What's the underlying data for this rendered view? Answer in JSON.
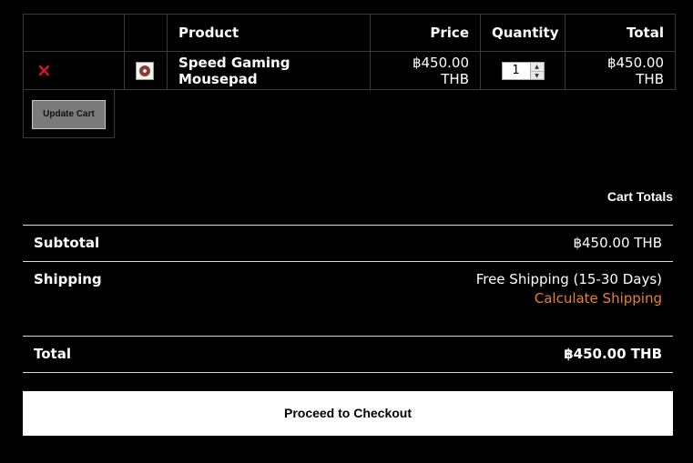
{
  "cart": {
    "columns": {
      "remove": "",
      "thumbnail": "",
      "product": "Product",
      "price": "Price",
      "quantity": "Quantity",
      "total": "Total"
    },
    "items": [
      {
        "remove_icon": "×",
        "thumbnail_icon": "mousepad-thumbnail",
        "product": "Speed Gaming Mousepad",
        "price": "฿450.00 THB",
        "quantity": "1",
        "total": "฿450.00 THB"
      }
    ],
    "update_button": "Update Cart"
  },
  "totals": {
    "heading": "Cart Totals",
    "subtotal_label": "Subtotal",
    "subtotal_value": "฿450.00 THB",
    "shipping_label": "Shipping",
    "shipping_value": "Free Shipping (15-30 Days)",
    "calculate_shipping": "Calculate Shipping",
    "total_label": "Total",
    "total_value": "฿450.00 THB"
  },
  "checkout_button": "Proceed to Checkout",
  "colors": {
    "background": "#000000",
    "remove": "#e0142a",
    "link": "#e88030",
    "checkout_bg": "#ffffff"
  }
}
